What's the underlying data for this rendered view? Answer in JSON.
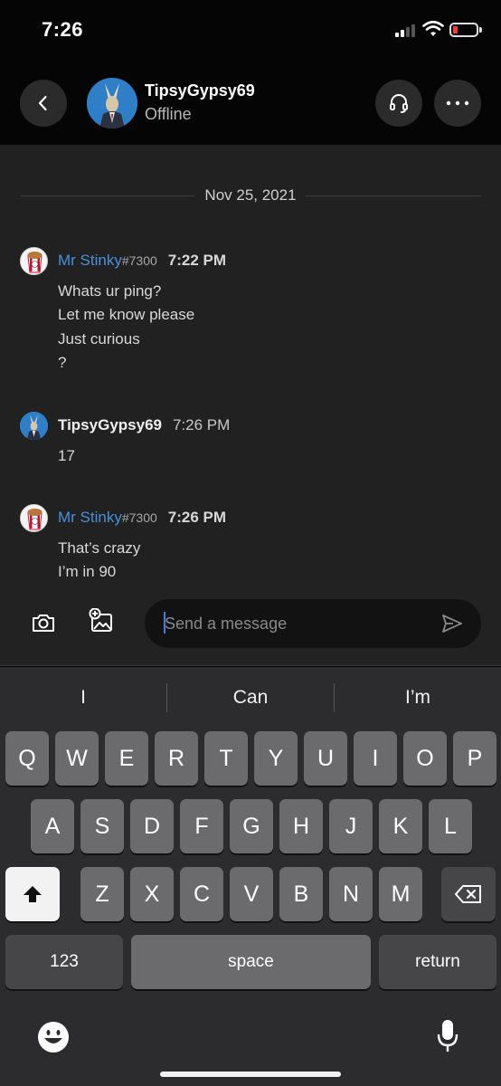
{
  "status_bar": {
    "time": "7:26"
  },
  "header": {
    "contact_name": "TipsyGypsy69",
    "contact_status": "Offline"
  },
  "chat": {
    "date_separator": "Nov 25, 2021",
    "messages": [
      {
        "author": "Mr Stinky",
        "tag": "#7300",
        "time": "7:22 PM",
        "lines": [
          "Whats ur ping?",
          "Let me know please",
          "Just curious",
          "?"
        ]
      },
      {
        "author": "TipsyGypsy69",
        "tag": "",
        "time": "7:26 PM",
        "lines": [
          "17"
        ]
      },
      {
        "author": "Mr Stinky",
        "tag": "#7300",
        "time": "7:26 PM",
        "lines": [
          "That’s crazy",
          "I’m in 90"
        ]
      }
    ]
  },
  "composer": {
    "placeholder": "Send a message"
  },
  "keyboard": {
    "suggestions": [
      "I",
      "Can",
      "I’m"
    ],
    "row1": [
      "Q",
      "W",
      "E",
      "R",
      "T",
      "Y",
      "U",
      "I",
      "O",
      "P"
    ],
    "row2": [
      "A",
      "S",
      "D",
      "F",
      "G",
      "H",
      "J",
      "K",
      "L"
    ],
    "row3": [
      "Z",
      "X",
      "C",
      "V",
      "B",
      "N",
      "M"
    ],
    "numbers_label": "123",
    "space_label": "space",
    "return_label": "return"
  },
  "colors": {
    "link": "#4a90d9",
    "chat_bg": "#212121",
    "battery_low": "#ff3b30"
  },
  "icons": [
    "back-icon",
    "headset-icon",
    "more-icon",
    "camera-icon",
    "add-image-icon",
    "send-icon",
    "shift-icon",
    "delete-icon",
    "emoji-icon",
    "microphone-icon"
  ]
}
